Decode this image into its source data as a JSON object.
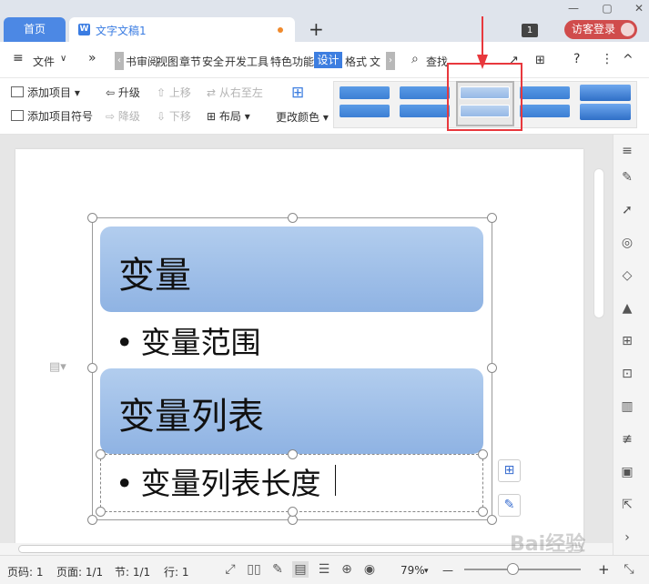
{
  "titlebar": {
    "home_tab": "首页",
    "doc_tab": "文字文稿1",
    "doc_icon": "W",
    "new_tab": "+",
    "badge": "1",
    "login": "访客登录",
    "win_controls": [
      "—",
      "▢",
      "✕"
    ]
  },
  "menubar": {
    "file": "文件",
    "more": "»",
    "tabs": [
      "书审阅",
      "视图",
      "章节",
      "安全",
      "开发工具",
      "特色功能",
      "设计",
      "格式",
      "文"
    ],
    "left_arrow": "‹",
    "right_arrow": "›",
    "search": "查找",
    "help": "?",
    "menu_dots": "⋮",
    "collapse": "^"
  },
  "ribbon": {
    "add_item": "添加项目",
    "add_bullet": "添加项目符号",
    "promote": "升级",
    "demote": "降级",
    "move_up": "上移",
    "move_down": "下移",
    "right_to_left": "从右至左",
    "layout": "布局",
    "change_color": "更改颜色"
  },
  "smartart": {
    "box1": "变量",
    "bullet1": "变量范围",
    "box2": "变量列表",
    "bullet2": "变量列表长度"
  },
  "statusbar": {
    "page_num": "页码: 1",
    "pages": "页面: 1/1",
    "section": "节: 1/1",
    "row": "行: 1",
    "zoom": "79%",
    "zoom_minus": "—",
    "zoom_plus": "+"
  },
  "watermark": "Bai经验",
  "colors": {
    "accent": "#3d7ee0",
    "smart_fill": "#a7c4ec",
    "highlight": "#e8383d",
    "login": "#d04c4c"
  }
}
